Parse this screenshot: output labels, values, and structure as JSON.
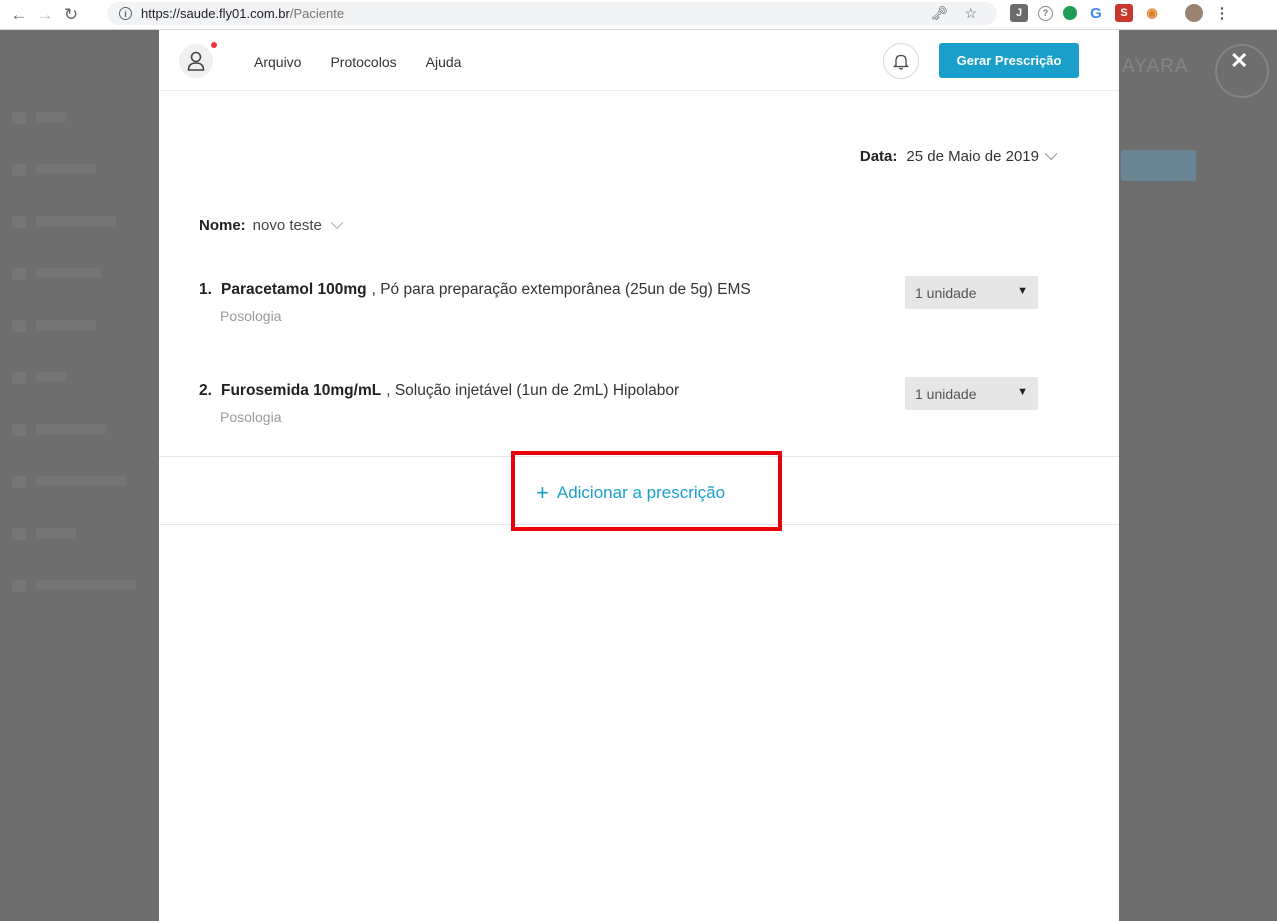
{
  "browser": {
    "url_host": "https://saude.fly01.com.br",
    "url_path": "/Paciente"
  },
  "background": {
    "visible_name": "AYARA"
  },
  "topbar": {
    "menu": [
      "Arquivo",
      "Protocolos",
      "Ajuda"
    ],
    "gerar_label": "Gerar Prescrição"
  },
  "header": {
    "date_label": "Data:",
    "date_value": "25 de Maio de 2019",
    "name_label": "Nome:",
    "name_value": "novo teste"
  },
  "items": [
    {
      "num": "1.",
      "drug": "Paracetamol 100mg",
      "desc": ", Pó para preparação extemporânea (25un de 5g) EMS",
      "posologia": "Posologia",
      "qty": "1 unidade"
    },
    {
      "num": "2.",
      "drug": "Furosemida 10mg/mL",
      "desc": ", Solução injetável (1un de 2mL) Hipolabor",
      "posologia": "Posologia",
      "qty": "1 unidade"
    }
  ],
  "add": {
    "plus": "+",
    "label": "Adicionar a prescrição"
  },
  "colors": {
    "accent": "#1a9fca",
    "highlight": "#e8000b"
  }
}
